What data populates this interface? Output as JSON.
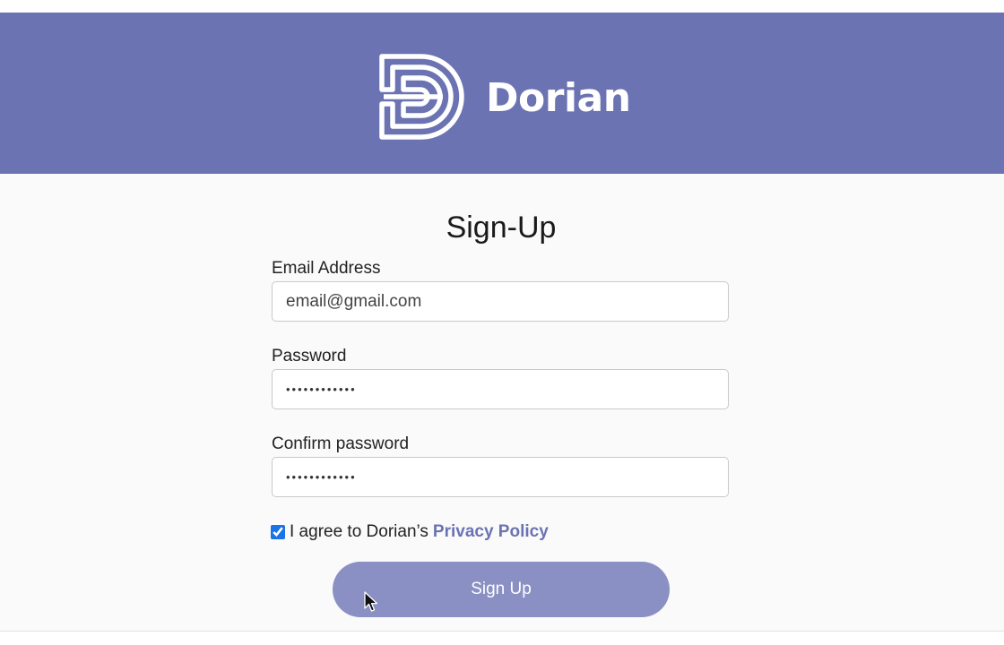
{
  "brand": {
    "name": "Dorian",
    "color": "#6b73b2"
  },
  "form": {
    "title": "Sign-Up",
    "email": {
      "label": "Email Address",
      "value": "email@gmail.com"
    },
    "password": {
      "label": "Password",
      "value": "••••••••••••"
    },
    "confirm_password": {
      "label": "Confirm password",
      "value": "••••••••••••"
    },
    "agree": {
      "checked": true,
      "text": "I agree to Dorian’s",
      "link_label": "Privacy Policy"
    },
    "submit_label": "Sign Up",
    "submit_color": "#8a90c3"
  },
  "icons": {
    "logo": "dorian-d-logo-icon",
    "cursor": "mouse-pointer-icon"
  }
}
